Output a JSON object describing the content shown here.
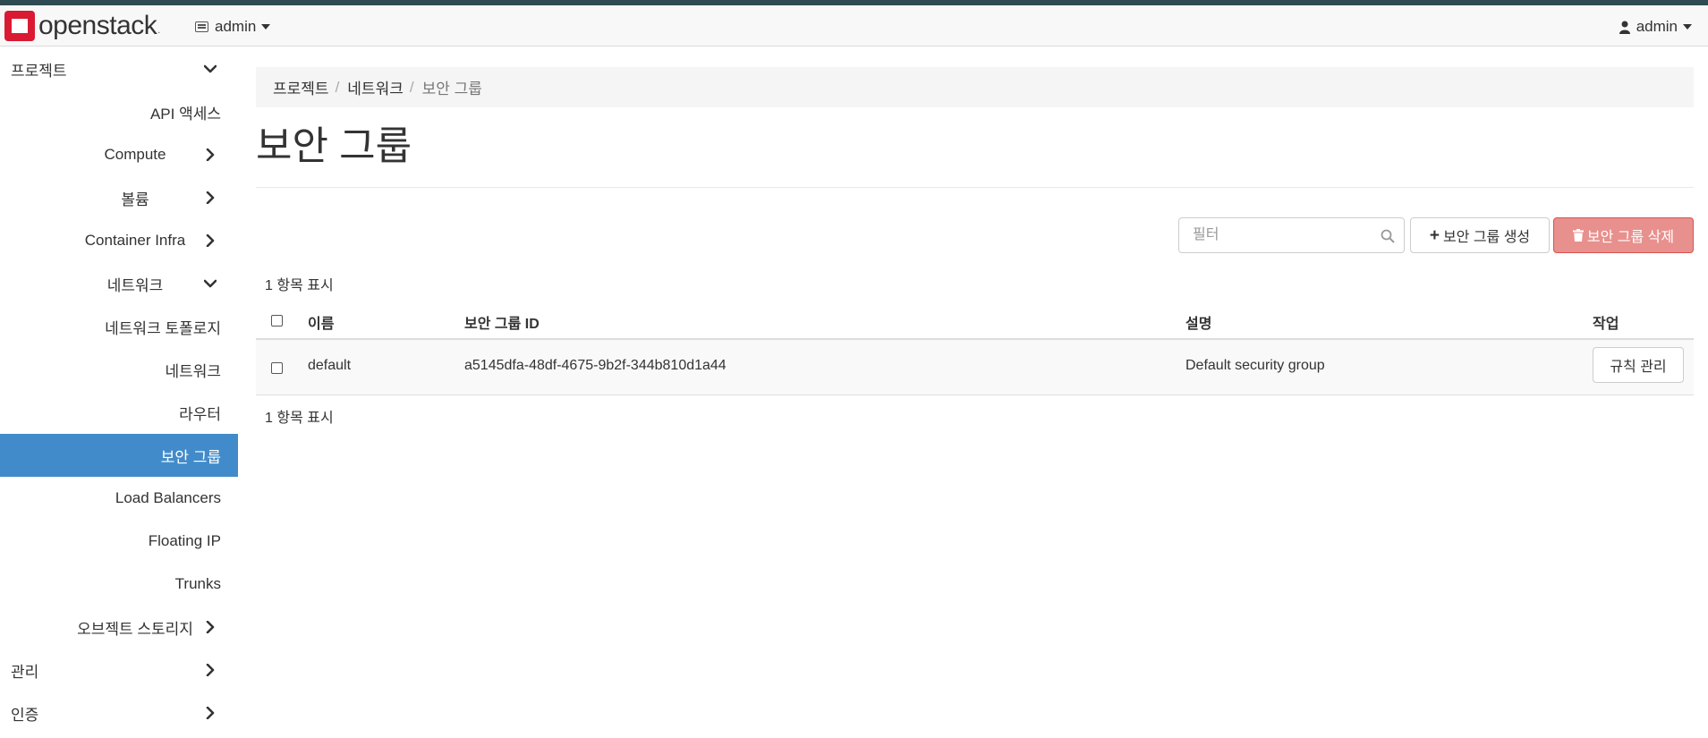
{
  "navbar": {
    "brand": "openstack",
    "brand_reg": ".",
    "project": "admin",
    "user": "admin"
  },
  "sidebar": {
    "items": [
      {
        "label": "프로젝트",
        "level": 0,
        "chevron": "chevron-down"
      },
      {
        "label": "API 액세스",
        "level": 2
      },
      {
        "label": "Compute",
        "level": 1,
        "chevron": "chevron-right"
      },
      {
        "label": "볼륨",
        "level": 1,
        "chevron": "chevron-right"
      },
      {
        "label": "Container Infra",
        "level": 1,
        "chevron": "chevron-right"
      },
      {
        "label": "네트워크",
        "level": 1,
        "chevron": "chevron-down"
      },
      {
        "label": "네트워크 토폴로지",
        "level": 2
      },
      {
        "label": "네트워크",
        "level": 2
      },
      {
        "label": "라우터",
        "level": 2
      },
      {
        "label": "보안 그룹",
        "level": 2,
        "active": true
      },
      {
        "label": "Load Balancers",
        "level": 2
      },
      {
        "label": "Floating IP",
        "level": 2
      },
      {
        "label": "Trunks",
        "level": 2
      },
      {
        "label": "오브젝트 스토리지",
        "level": 1,
        "chevron": "chevron-right"
      },
      {
        "label": "관리",
        "level": 0,
        "chevron": "chevron-right"
      },
      {
        "label": "인증",
        "level": 0,
        "chevron": "chevron-right"
      }
    ]
  },
  "breadcrumb": {
    "items": [
      "프로젝트",
      "네트워크",
      "보안 그룹"
    ],
    "separator": "/"
  },
  "page": {
    "title": "보안 그룹"
  },
  "toolbar": {
    "filter_placeholder": "필터",
    "create_label": "보안 그룹 생성",
    "delete_label": "보안 그룹 삭제"
  },
  "table": {
    "count_text": "1 항목 표시",
    "columns": [
      "이름",
      "보안 그룹 ID",
      "설명",
      "작업"
    ],
    "rows": [
      {
        "name": "default",
        "id": "a5145dfa-48df-4675-9b2f-344b810d1a44",
        "description": "Default security group",
        "action": "규칙 관리"
      }
    ]
  },
  "colors": {
    "active_nav": "#428bca",
    "delete_button": "#e8908d",
    "brand_red": "#da1a32",
    "top_stripe": "#2f4a52"
  }
}
